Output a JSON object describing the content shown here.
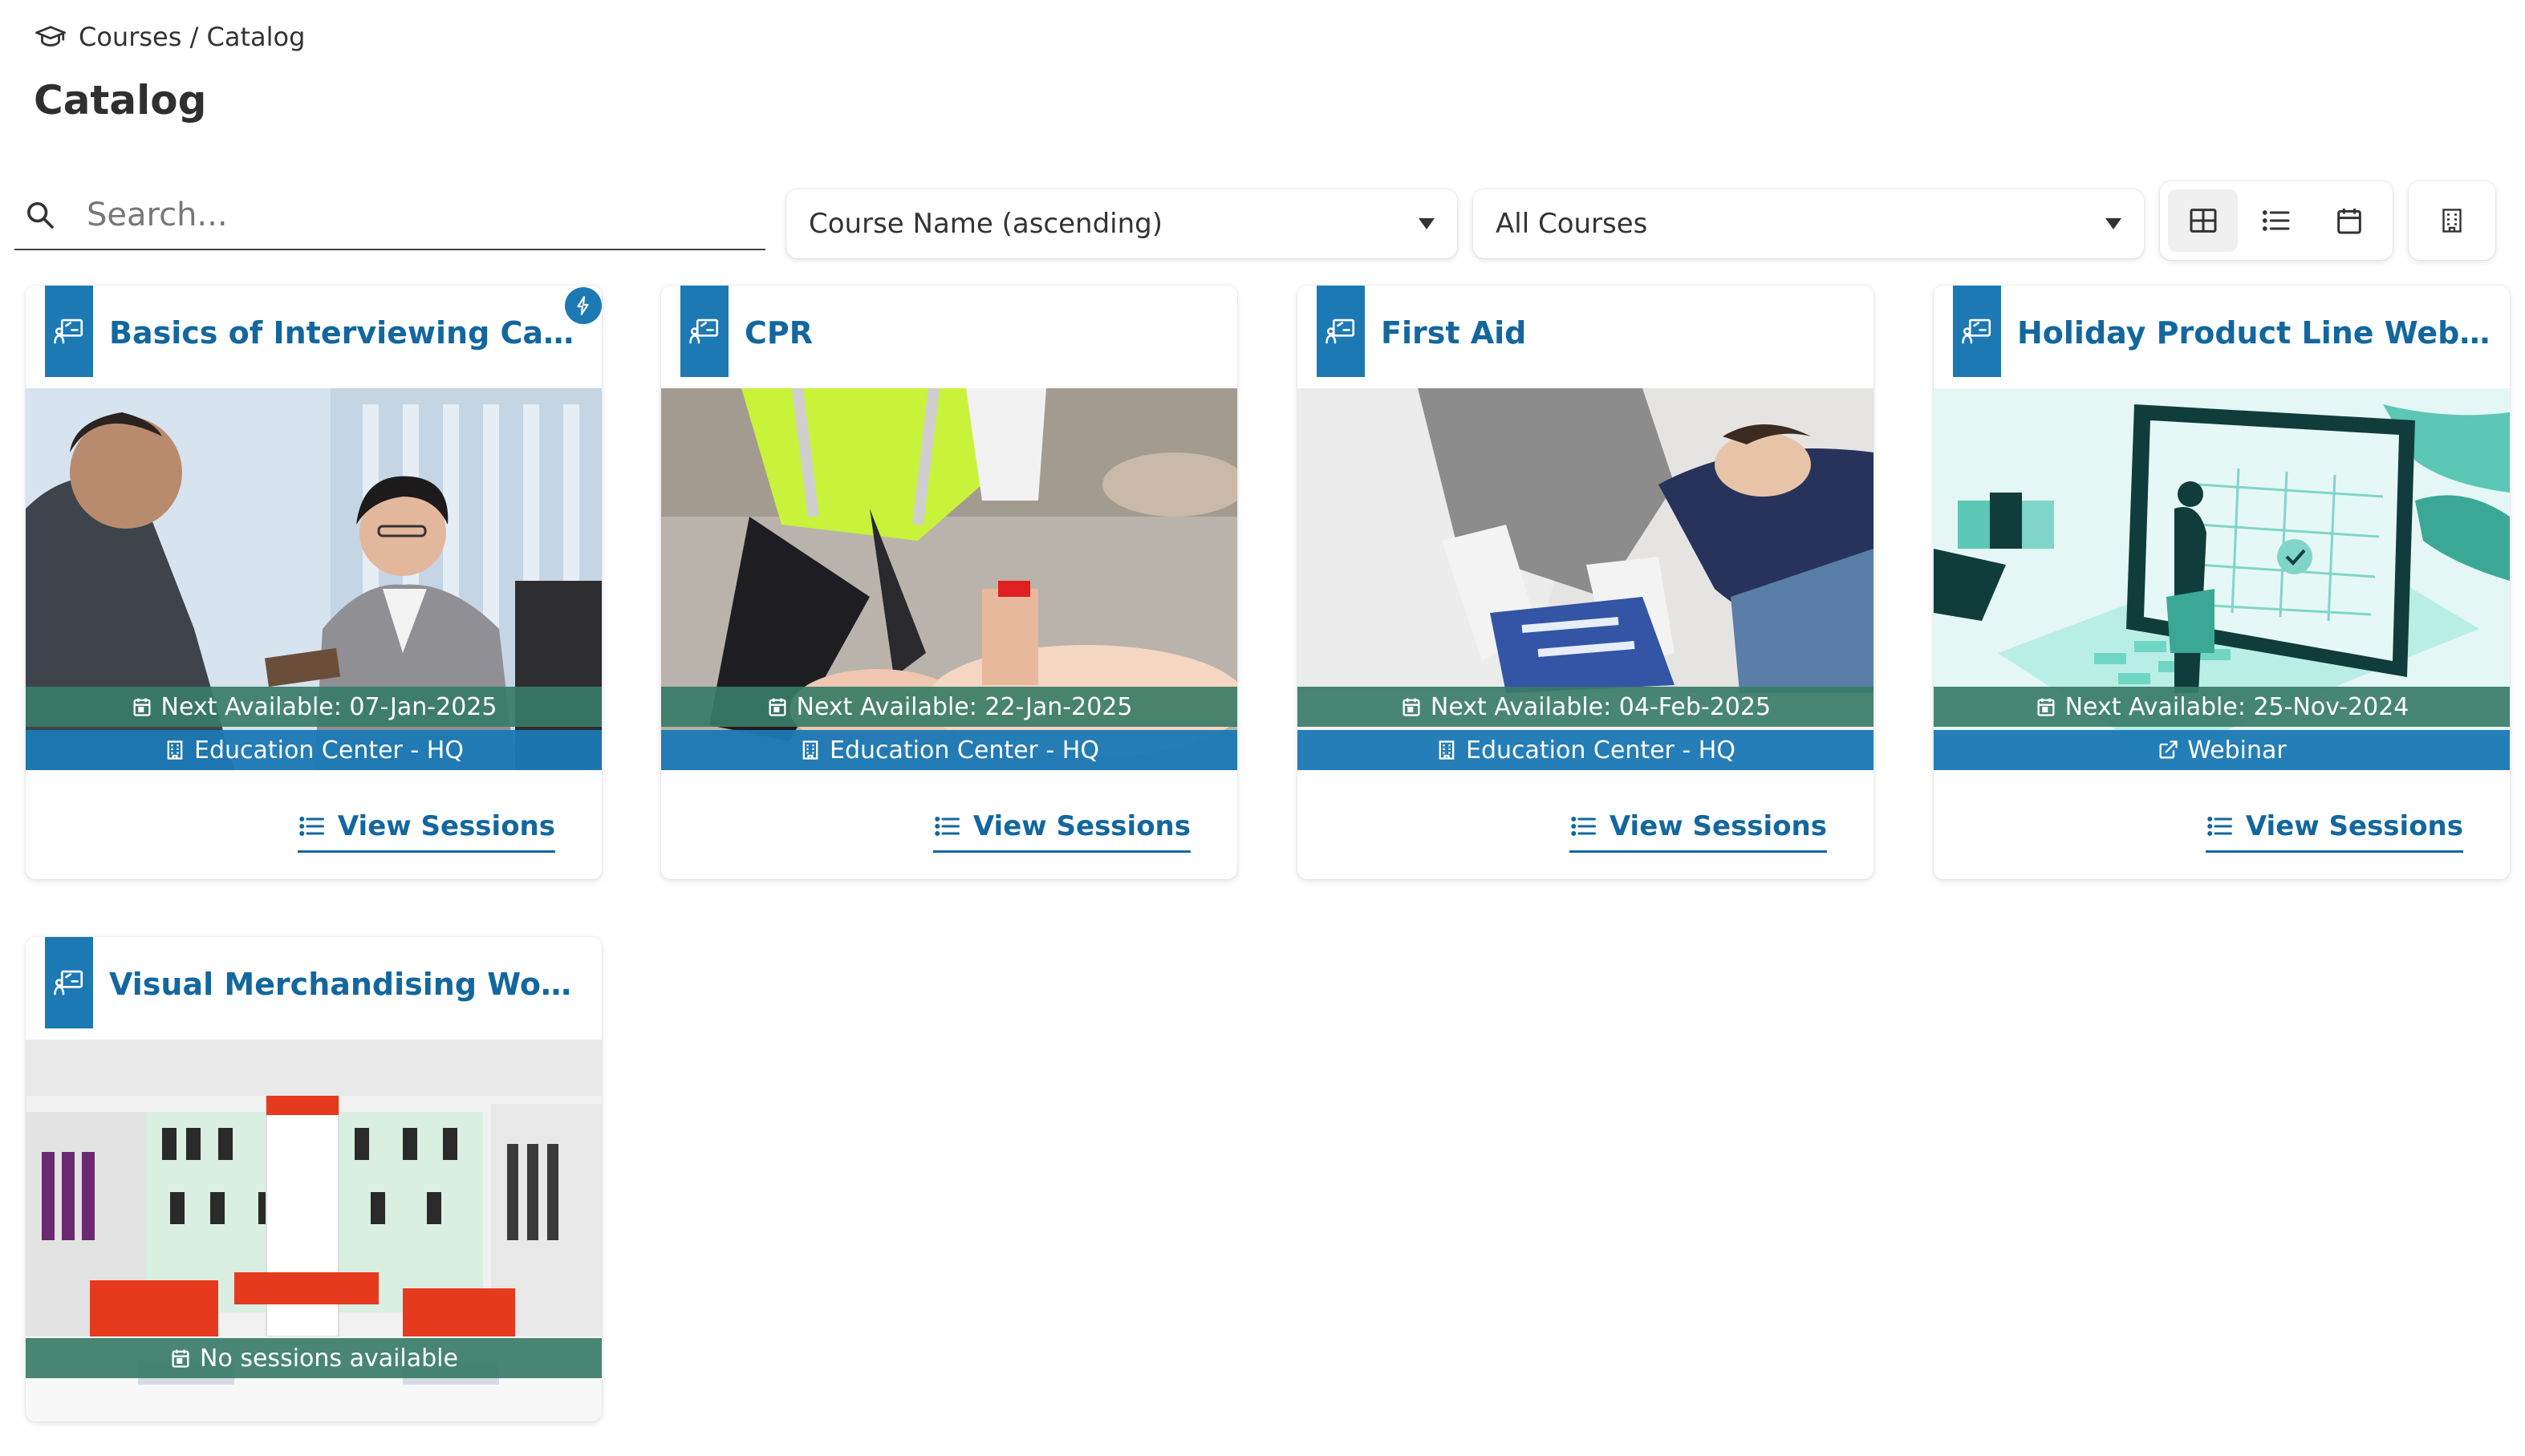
{
  "breadcrumb": {
    "text": "Courses / Catalog"
  },
  "page_title": "Catalog",
  "search": {
    "placeholder": "Search..."
  },
  "sort": {
    "selected": "Course Name (ascending)"
  },
  "filter": {
    "selected": "All Courses"
  },
  "view_modes": [
    "grid",
    "list",
    "calendar"
  ],
  "accent_colors": {
    "blue": "#1c79b4",
    "title_blue": "#13679e",
    "green": "#387c67"
  },
  "courses": [
    {
      "title": "Basics of Interviewing Candida...",
      "next": "Next Available: 07-Jan-2025",
      "location": "Education Center - HQ",
      "action": "View Sessions"
    },
    {
      "title": "CPR",
      "next": "Next Available: 22-Jan-2025",
      "location": "Education Center - HQ",
      "action": "View Sessions"
    },
    {
      "title": "First Aid",
      "next": "Next Available: 04-Feb-2025",
      "location": "Education Center - HQ",
      "action": "View Sessions"
    },
    {
      "title": "Holiday Product Line Webinar",
      "next": "Next Available: 25-Nov-2024",
      "location": "Webinar",
      "action": "View Sessions"
    },
    {
      "title": "Visual Merchandising Workshop",
      "next": "No sessions available"
    }
  ]
}
